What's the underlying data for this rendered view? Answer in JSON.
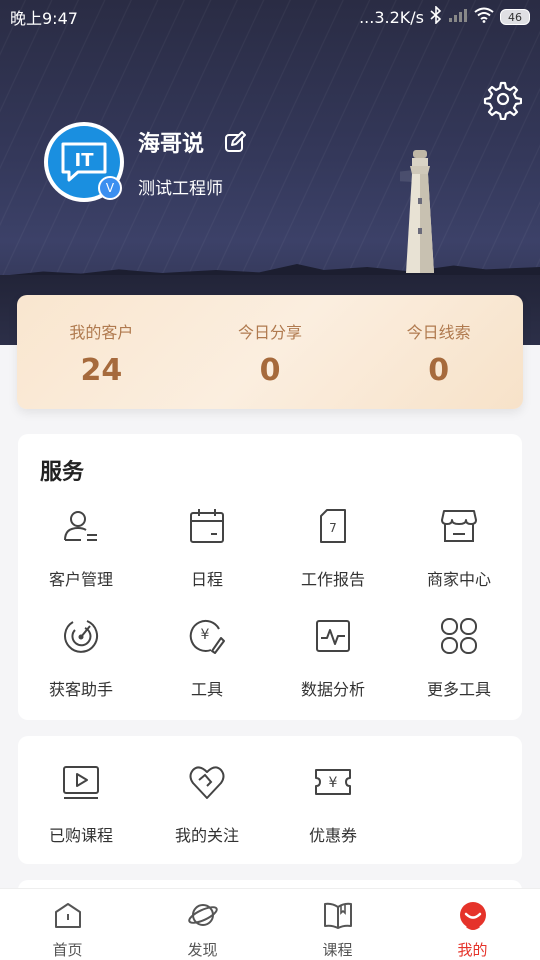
{
  "status_bar": {
    "time": "晚上9:47",
    "network_speed": "...3.2K/s",
    "battery": "46"
  },
  "profile": {
    "avatar_text": "IT",
    "name": "海哥说",
    "title": "测试工程师",
    "verified_mark": "V"
  },
  "stats": [
    {
      "label": "我的客户",
      "value": "24"
    },
    {
      "label": "今日分享",
      "value": "0"
    },
    {
      "label": "今日线索",
      "value": "0"
    }
  ],
  "services": {
    "heading": "服务",
    "items": [
      {
        "label": "客户管理",
        "icon": "customer-icon"
      },
      {
        "label": "日程",
        "icon": "calendar-icon"
      },
      {
        "label": "工作报告",
        "icon": "report-icon",
        "icon_text": "7"
      },
      {
        "label": "商家中心",
        "icon": "store-icon"
      },
      {
        "label": "获客助手",
        "icon": "radar-icon"
      },
      {
        "label": "工具",
        "icon": "tool-icon",
        "icon_text": "¥"
      },
      {
        "label": "数据分析",
        "icon": "chart-icon"
      },
      {
        "label": "更多工具",
        "icon": "more-icon"
      }
    ]
  },
  "mine": {
    "items": [
      {
        "label": "已购课程",
        "icon": "video-icon"
      },
      {
        "label": "我的关注",
        "icon": "heart-icon"
      },
      {
        "label": "优惠券",
        "icon": "coupon-icon",
        "icon_text": "¥"
      }
    ]
  },
  "tabbar": {
    "items": [
      {
        "label": "首页",
        "icon": "home-icon",
        "active": false
      },
      {
        "label": "发现",
        "icon": "planet-icon",
        "active": false
      },
      {
        "label": "课程",
        "icon": "book-icon",
        "active": false
      },
      {
        "label": "我的",
        "icon": "profile-icon",
        "active": true
      }
    ]
  },
  "colors": {
    "accent": "#e5332a",
    "stat_text": "#a66a3c",
    "avatar_blue": "#1a8fe0"
  }
}
